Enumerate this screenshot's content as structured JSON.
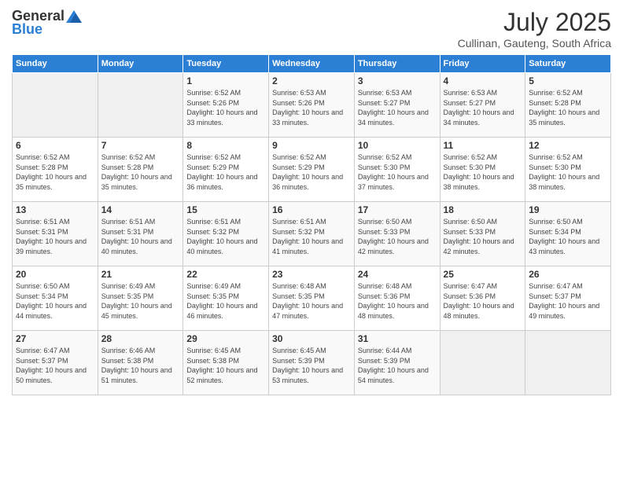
{
  "header": {
    "logo_general": "General",
    "logo_blue": "Blue",
    "title": "July 2025",
    "subtitle": "Cullinan, Gauteng, South Africa"
  },
  "weekdays": [
    "Sunday",
    "Monday",
    "Tuesday",
    "Wednesday",
    "Thursday",
    "Friday",
    "Saturday"
  ],
  "weeks": [
    [
      {
        "day": "",
        "sunrise": "",
        "sunset": "",
        "daylight": ""
      },
      {
        "day": "",
        "sunrise": "",
        "sunset": "",
        "daylight": ""
      },
      {
        "day": "1",
        "sunrise": "Sunrise: 6:52 AM",
        "sunset": "Sunset: 5:26 PM",
        "daylight": "Daylight: 10 hours and 33 minutes."
      },
      {
        "day": "2",
        "sunrise": "Sunrise: 6:53 AM",
        "sunset": "Sunset: 5:26 PM",
        "daylight": "Daylight: 10 hours and 33 minutes."
      },
      {
        "day": "3",
        "sunrise": "Sunrise: 6:53 AM",
        "sunset": "Sunset: 5:27 PM",
        "daylight": "Daylight: 10 hours and 34 minutes."
      },
      {
        "day": "4",
        "sunrise": "Sunrise: 6:53 AM",
        "sunset": "Sunset: 5:27 PM",
        "daylight": "Daylight: 10 hours and 34 minutes."
      },
      {
        "day": "5",
        "sunrise": "Sunrise: 6:52 AM",
        "sunset": "Sunset: 5:28 PM",
        "daylight": "Daylight: 10 hours and 35 minutes."
      }
    ],
    [
      {
        "day": "6",
        "sunrise": "Sunrise: 6:52 AM",
        "sunset": "Sunset: 5:28 PM",
        "daylight": "Daylight: 10 hours and 35 minutes."
      },
      {
        "day": "7",
        "sunrise": "Sunrise: 6:52 AM",
        "sunset": "Sunset: 5:28 PM",
        "daylight": "Daylight: 10 hours and 35 minutes."
      },
      {
        "day": "8",
        "sunrise": "Sunrise: 6:52 AM",
        "sunset": "Sunset: 5:29 PM",
        "daylight": "Daylight: 10 hours and 36 minutes."
      },
      {
        "day": "9",
        "sunrise": "Sunrise: 6:52 AM",
        "sunset": "Sunset: 5:29 PM",
        "daylight": "Daylight: 10 hours and 36 minutes."
      },
      {
        "day": "10",
        "sunrise": "Sunrise: 6:52 AM",
        "sunset": "Sunset: 5:30 PM",
        "daylight": "Daylight: 10 hours and 37 minutes."
      },
      {
        "day": "11",
        "sunrise": "Sunrise: 6:52 AM",
        "sunset": "Sunset: 5:30 PM",
        "daylight": "Daylight: 10 hours and 38 minutes."
      },
      {
        "day": "12",
        "sunrise": "Sunrise: 6:52 AM",
        "sunset": "Sunset: 5:30 PM",
        "daylight": "Daylight: 10 hours and 38 minutes."
      }
    ],
    [
      {
        "day": "13",
        "sunrise": "Sunrise: 6:51 AM",
        "sunset": "Sunset: 5:31 PM",
        "daylight": "Daylight: 10 hours and 39 minutes."
      },
      {
        "day": "14",
        "sunrise": "Sunrise: 6:51 AM",
        "sunset": "Sunset: 5:31 PM",
        "daylight": "Daylight: 10 hours and 40 minutes."
      },
      {
        "day": "15",
        "sunrise": "Sunrise: 6:51 AM",
        "sunset": "Sunset: 5:32 PM",
        "daylight": "Daylight: 10 hours and 40 minutes."
      },
      {
        "day": "16",
        "sunrise": "Sunrise: 6:51 AM",
        "sunset": "Sunset: 5:32 PM",
        "daylight": "Daylight: 10 hours and 41 minutes."
      },
      {
        "day": "17",
        "sunrise": "Sunrise: 6:50 AM",
        "sunset": "Sunset: 5:33 PM",
        "daylight": "Daylight: 10 hours and 42 minutes."
      },
      {
        "day": "18",
        "sunrise": "Sunrise: 6:50 AM",
        "sunset": "Sunset: 5:33 PM",
        "daylight": "Daylight: 10 hours and 42 minutes."
      },
      {
        "day": "19",
        "sunrise": "Sunrise: 6:50 AM",
        "sunset": "Sunset: 5:34 PM",
        "daylight": "Daylight: 10 hours and 43 minutes."
      }
    ],
    [
      {
        "day": "20",
        "sunrise": "Sunrise: 6:50 AM",
        "sunset": "Sunset: 5:34 PM",
        "daylight": "Daylight: 10 hours and 44 minutes."
      },
      {
        "day": "21",
        "sunrise": "Sunrise: 6:49 AM",
        "sunset": "Sunset: 5:35 PM",
        "daylight": "Daylight: 10 hours and 45 minutes."
      },
      {
        "day": "22",
        "sunrise": "Sunrise: 6:49 AM",
        "sunset": "Sunset: 5:35 PM",
        "daylight": "Daylight: 10 hours and 46 minutes."
      },
      {
        "day": "23",
        "sunrise": "Sunrise: 6:48 AM",
        "sunset": "Sunset: 5:35 PM",
        "daylight": "Daylight: 10 hours and 47 minutes."
      },
      {
        "day": "24",
        "sunrise": "Sunrise: 6:48 AM",
        "sunset": "Sunset: 5:36 PM",
        "daylight": "Daylight: 10 hours and 48 minutes."
      },
      {
        "day": "25",
        "sunrise": "Sunrise: 6:47 AM",
        "sunset": "Sunset: 5:36 PM",
        "daylight": "Daylight: 10 hours and 48 minutes."
      },
      {
        "day": "26",
        "sunrise": "Sunrise: 6:47 AM",
        "sunset": "Sunset: 5:37 PM",
        "daylight": "Daylight: 10 hours and 49 minutes."
      }
    ],
    [
      {
        "day": "27",
        "sunrise": "Sunrise: 6:47 AM",
        "sunset": "Sunset: 5:37 PM",
        "daylight": "Daylight: 10 hours and 50 minutes."
      },
      {
        "day": "28",
        "sunrise": "Sunrise: 6:46 AM",
        "sunset": "Sunset: 5:38 PM",
        "daylight": "Daylight: 10 hours and 51 minutes."
      },
      {
        "day": "29",
        "sunrise": "Sunrise: 6:45 AM",
        "sunset": "Sunset: 5:38 PM",
        "daylight": "Daylight: 10 hours and 52 minutes."
      },
      {
        "day": "30",
        "sunrise": "Sunrise: 6:45 AM",
        "sunset": "Sunset: 5:39 PM",
        "daylight": "Daylight: 10 hours and 53 minutes."
      },
      {
        "day": "31",
        "sunrise": "Sunrise: 6:44 AM",
        "sunset": "Sunset: 5:39 PM",
        "daylight": "Daylight: 10 hours and 54 minutes."
      },
      {
        "day": "",
        "sunrise": "",
        "sunset": "",
        "daylight": ""
      },
      {
        "day": "",
        "sunrise": "",
        "sunset": "",
        "daylight": ""
      }
    ]
  ]
}
